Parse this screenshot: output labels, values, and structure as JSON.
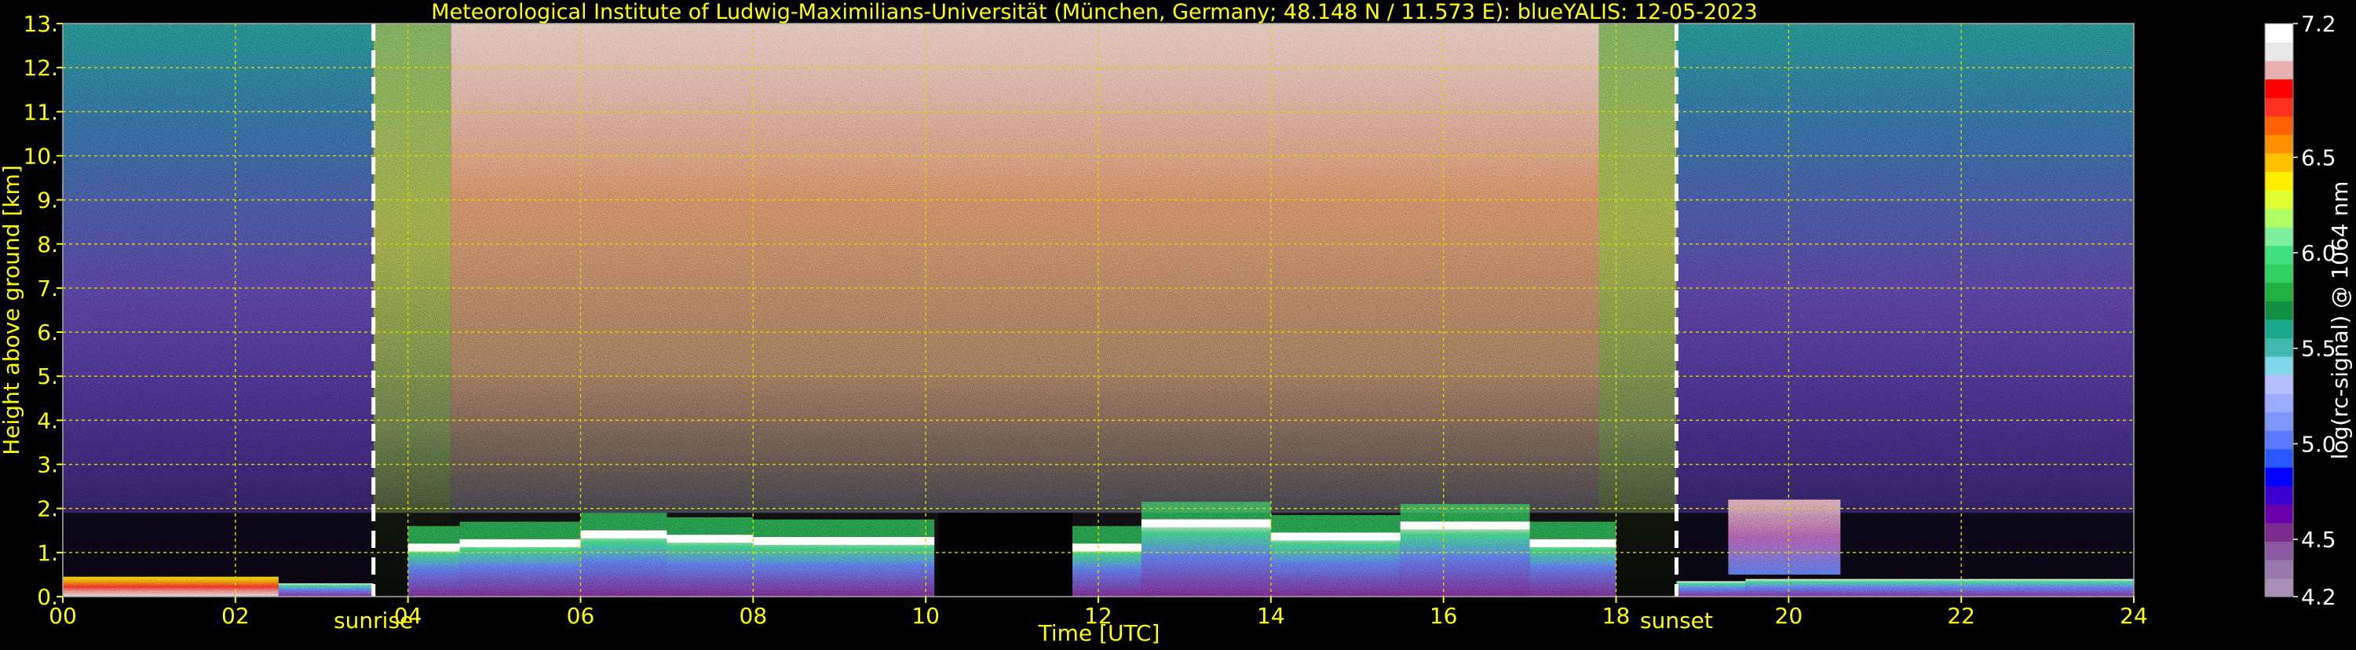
{
  "chart_data": {
    "type": "heatmap",
    "title": "Meteorological Institute of Ludwig-Maximilians-Universität (München, Germany; 48.148 N / 11.573 E):    blueYALIS: 12-05-2023",
    "xlabel": "Time [UTC]",
    "ylabel": "Height above ground [km]",
    "xlim": [
      0,
      24
    ],
    "ylim": [
      0,
      13
    ],
    "x_ticks": [
      "00",
      "02",
      "04",
      "06",
      "08",
      "10",
      "12",
      "14",
      "16",
      "18",
      "20",
      "22",
      "24"
    ],
    "y_ticks": [
      "0.",
      "1.",
      "2.",
      "3.",
      "4.",
      "5.",
      "6.",
      "7.",
      "8.",
      "9.",
      "10.",
      "11.",
      "12.",
      "13."
    ],
    "grid": true,
    "annotations": [
      {
        "label": "sunrise",
        "x": 3.6
      },
      {
        "label": "sunset",
        "x": 18.7
      }
    ],
    "colorbar": {
      "label": "log(rc-signal) @ 1064 nm",
      "range": [
        4.2,
        7.2
      ],
      "ticks": [
        "4.2",
        "4.5",
        "5.0",
        "5.5",
        "6.0",
        "6.5",
        "7.2"
      ],
      "colors": [
        "#a890b8",
        "#9a78ae",
        "#8c5aa0",
        "#7a2a8a",
        "#6a00a8",
        "#3a00d0",
        "#0000ff",
        "#2a5aff",
        "#5a7aff",
        "#7e96ff",
        "#9eacff",
        "#b8c0ff",
        "#80d8e8",
        "#40b8b0",
        "#1aa88a",
        "#109040",
        "#20b040",
        "#30d060",
        "#40e080",
        "#80f0a0",
        "#b0ff60",
        "#e0ff30",
        "#ffee00",
        "#ffc000",
        "#ff9000",
        "#ff6000",
        "#ff3020",
        "#ff0000",
        "#e8b0b0",
        "#e8e8e8",
        "#ffffff"
      ]
    },
    "gaps_utc": [
      [
        10.15,
        11.7
      ]
    ],
    "cloud_base_km": [
      {
        "from": 4.0,
        "to": 4.6,
        "base": 1.15
      },
      {
        "from": 4.6,
        "to": 6.0,
        "base": 1.25
      },
      {
        "from": 6.0,
        "to": 7.0,
        "base": 1.45
      },
      {
        "from": 7.0,
        "to": 8.0,
        "base": 1.35
      },
      {
        "from": 8.0,
        "to": 10.1,
        "base": 1.3
      },
      {
        "from": 11.7,
        "to": 12.5,
        "base": 1.15
      },
      {
        "from": 12.5,
        "to": 14.0,
        "base": 1.7
      },
      {
        "from": 14.0,
        "to": 15.5,
        "base": 1.4
      },
      {
        "from": 15.5,
        "to": 17.0,
        "base": 1.65
      },
      {
        "from": 17.0,
        "to": 18.0,
        "base": 1.25
      }
    ],
    "boundary_layer_km": [
      {
        "from": 0.0,
        "to": 2.5,
        "top": 0.45
      },
      {
        "from": 2.5,
        "to": 3.6,
        "top": 0.3
      },
      {
        "from": 18.7,
        "to": 19.5,
        "top": 0.35
      },
      {
        "from": 19.5,
        "to": 24.0,
        "top": 0.4
      }
    ],
    "elevated_layer_km": [
      {
        "from": 19.3,
        "to": 20.6,
        "base": 0.5,
        "top": 2.2
      }
    ]
  }
}
